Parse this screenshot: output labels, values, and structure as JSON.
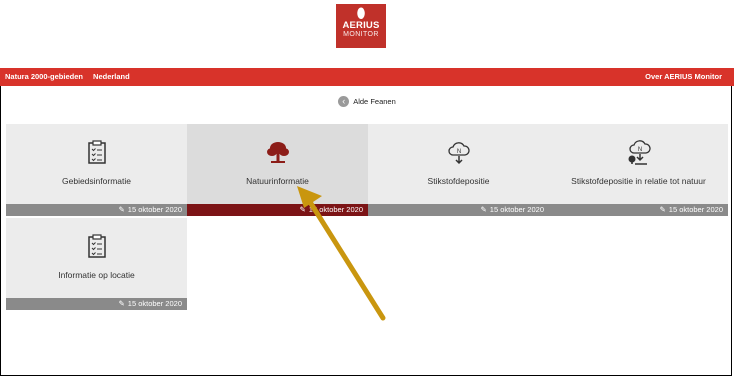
{
  "logo": {
    "line1": "AERIUS",
    "line2": "MONITOR",
    "mark": "⬮"
  },
  "topbar": {
    "left_items": [
      "Natura 2000-gebieden",
      "Nederland"
    ],
    "right": "Over AERIUS Monitor"
  },
  "area": {
    "back_glyph": "‹",
    "title": "Alde Feanen"
  },
  "tiles": [
    {
      "label": "Gebiedsinformatie",
      "date": "15 oktober 2020",
      "icon": "clipboard-icon"
    },
    {
      "label": "Natuurinformatie",
      "date": "15 oktober 2020",
      "icon": "tree-icon",
      "active": true
    },
    {
      "label": "Stikstofdepositie",
      "date": "15 oktober 2020",
      "icon": "cloud-n-icon"
    },
    {
      "label": "Stikstofdepositie in relatie tot natuur",
      "date": "15 oktober 2020",
      "icon": "cloud-n-tree-icon"
    },
    {
      "label": "Informatie op locatie",
      "date": "15 oktober 2020",
      "icon": "clipboard-icon"
    }
  ],
  "colors": {
    "brand": "#d8332a",
    "active_footer": "#7c1416",
    "footer": "#8a8a8a",
    "annotation_arrow": "#c9960f"
  }
}
